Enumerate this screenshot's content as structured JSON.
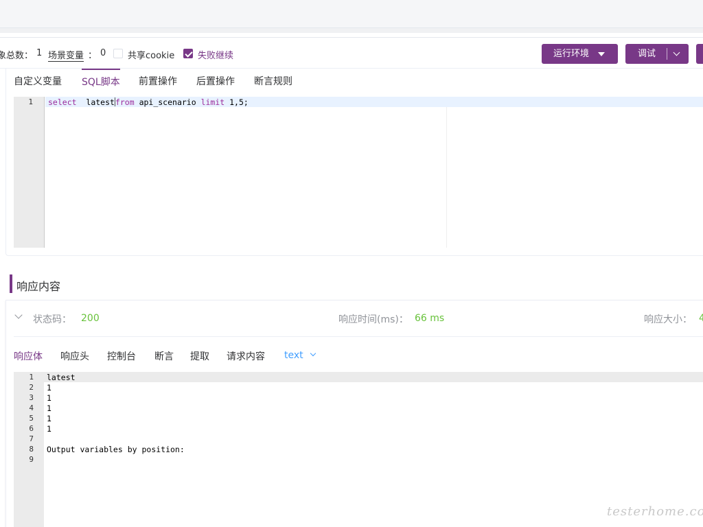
{
  "toolbar": {
    "total_label": "象总数：",
    "total_value": "1",
    "scene_var_label": "场景变量",
    "scene_var_colon": "：",
    "scene_var_value": "0",
    "share_cookie_label": "共享cookie",
    "share_cookie_checked": false,
    "fail_continue_label": "失败继续",
    "fail_continue_checked": true,
    "env_button_label": "运行环境",
    "debug_button_label": "调试"
  },
  "script_tabs": [
    "自定义变量",
    "SQL脚本",
    "前置操作",
    "后置操作",
    "断言规则"
  ],
  "script_tabs_active": "SQL脚本",
  "sql_editor": {
    "line_number": "1",
    "tokens": [
      "select",
      "  latest",
      "from",
      " api_scenario ",
      "limit",
      " 1,5;"
    ]
  },
  "response": {
    "title": "响应内容",
    "status_label": "状态码：",
    "status_value": "200",
    "time_label": "响应时间(ms)：",
    "time_value": "66 ms",
    "size_label": "响应大小：",
    "size_value": "4"
  },
  "response_tabs": [
    "响应体",
    "响应头",
    "控制台",
    "断言",
    "提取",
    "请求内容"
  ],
  "response_tabs_active": "响应体",
  "format_select": "text",
  "output": {
    "line_numbers": [
      "1",
      "2",
      "3",
      "4",
      "5",
      "6",
      "7",
      "8",
      "9"
    ],
    "lines": [
      "latest",
      "1",
      "1",
      "1",
      "1",
      "1",
      "",
      "Output variables by position:",
      ""
    ]
  },
  "watermark": "testerhome.com",
  "colors": {
    "accent": "#783887",
    "success": "#67c23a",
    "link": "#409eff"
  }
}
